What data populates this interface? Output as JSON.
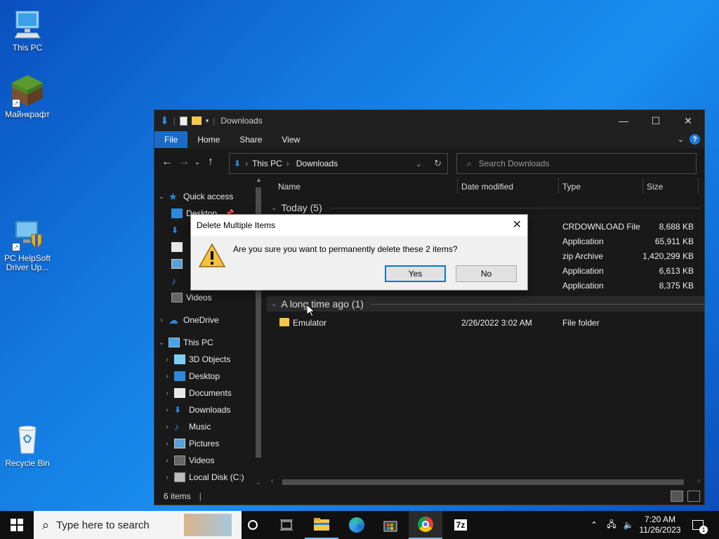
{
  "desktop": {
    "icons": [
      {
        "label": "This PC"
      },
      {
        "label": "Майнкрафт"
      },
      {
        "label": "PC HelpSoft Driver Up..."
      },
      {
        "label": "Recycle Bin"
      }
    ]
  },
  "window": {
    "title": "Downloads",
    "ribbon_tabs": [
      "File",
      "Home",
      "Share",
      "View"
    ],
    "address": {
      "crumbs": [
        "This PC",
        "Downloads"
      ]
    },
    "search_placeholder": "Search Downloads",
    "nav": {
      "quick_access": "Quick access",
      "quick_items": [
        "Desktop",
        "Videos"
      ],
      "onedrive": "OneDrive",
      "this_pc": "This PC",
      "pc_items": [
        "3D Objects",
        "Desktop",
        "Documents",
        "Downloads",
        "Music",
        "Pictures",
        "Videos",
        "Local Disk (C:)"
      ]
    },
    "columns": {
      "name": "Name",
      "date": "Date modified",
      "type": "Type",
      "size": "Size"
    },
    "groups": {
      "today": "Today (5)",
      "long_ago": "A long time ago (1)"
    },
    "today_rows": [
      {
        "type": "CRDOWNLOAD File",
        "size": "8,688 KB"
      },
      {
        "type": "Application",
        "size": "65,911 KB"
      },
      {
        "type": "zip Archive",
        "size": "1,420,299 KB"
      },
      {
        "type": "Application",
        "size": "6,613 KB"
      },
      {
        "type": "Application",
        "size": "8,375 KB"
      }
    ],
    "old_rows": [
      {
        "name": "Emulator",
        "date": "2/26/2022 3:02 AM",
        "type": "File folder"
      }
    ],
    "status": "6 items",
    "colors": {
      "accent": "#1a6bc6",
      "background": "#191919"
    }
  },
  "dialog": {
    "title": "Delete Multiple Items",
    "message": "Are you sure you want to permanently delete these 2 items?",
    "yes": "Yes",
    "no": "No"
  },
  "taskbar": {
    "search_placeholder": "Type here to search",
    "time": "7:20 AM",
    "date": "11/26/2023",
    "notifications": "1"
  }
}
